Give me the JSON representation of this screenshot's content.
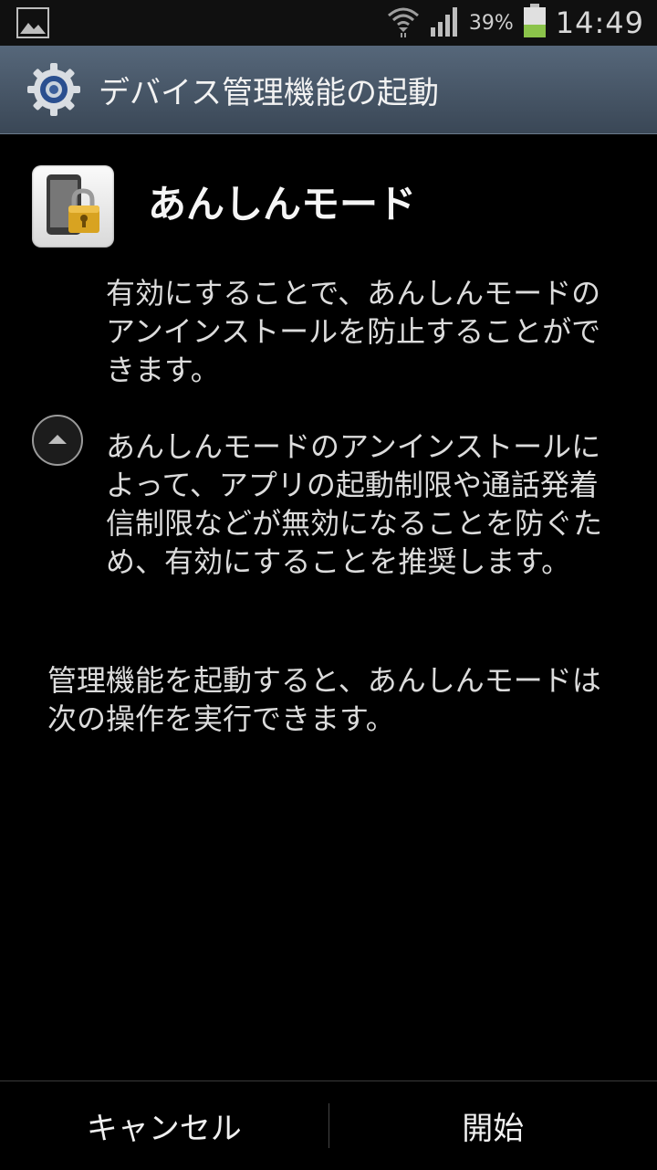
{
  "status_bar": {
    "battery_percent": "39%",
    "time": "14:49"
  },
  "title_bar": {
    "title": "デバイス管理機能の起動"
  },
  "app": {
    "name": "あんしんモード"
  },
  "content": {
    "para1": "有効にすることで、あんしんモードのアンインストールを防止することができます。",
    "para2": "あんしんモードのアンインストールによって、アプリの起動制限や通話発着信制限などが無効になることを防ぐため、有効にすることを推奨します。",
    "para3": "管理機能を起動すると、あんしんモードは次の操作を実行できます。"
  },
  "buttons": {
    "cancel": "キャンセル",
    "start": "開始"
  },
  "colors": {
    "title_bar": "#4a5a6b",
    "background": "#000000",
    "battery_fill": "#8bc34a"
  }
}
